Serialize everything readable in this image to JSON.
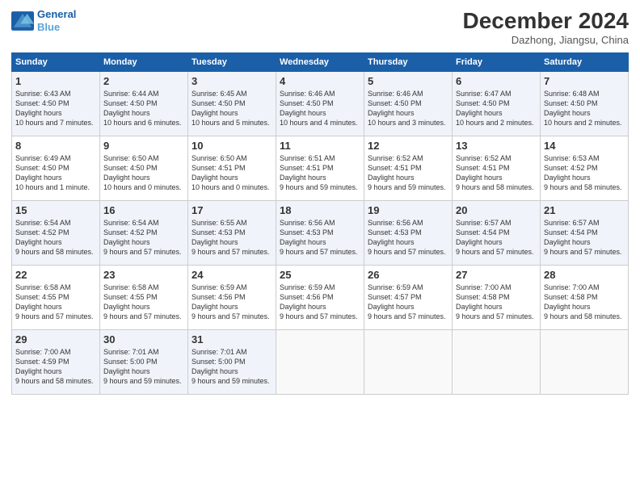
{
  "header": {
    "logo_line1": "General",
    "logo_line2": "Blue",
    "month": "December 2024",
    "location": "Dazhong, Jiangsu, China"
  },
  "weekdays": [
    "Sunday",
    "Monday",
    "Tuesday",
    "Wednesday",
    "Thursday",
    "Friday",
    "Saturday"
  ],
  "weeks": [
    [
      {
        "day": "1",
        "sunrise": "6:43 AM",
        "sunset": "4:50 PM",
        "daylight": "10 hours and 7 minutes."
      },
      {
        "day": "2",
        "sunrise": "6:44 AM",
        "sunset": "4:50 PM",
        "daylight": "10 hours and 6 minutes."
      },
      {
        "day": "3",
        "sunrise": "6:45 AM",
        "sunset": "4:50 PM",
        "daylight": "10 hours and 5 minutes."
      },
      {
        "day": "4",
        "sunrise": "6:46 AM",
        "sunset": "4:50 PM",
        "daylight": "10 hours and 4 minutes."
      },
      {
        "day": "5",
        "sunrise": "6:46 AM",
        "sunset": "4:50 PM",
        "daylight": "10 hours and 3 minutes."
      },
      {
        "day": "6",
        "sunrise": "6:47 AM",
        "sunset": "4:50 PM",
        "daylight": "10 hours and 2 minutes."
      },
      {
        "day": "7",
        "sunrise": "6:48 AM",
        "sunset": "4:50 PM",
        "daylight": "10 hours and 2 minutes."
      }
    ],
    [
      {
        "day": "8",
        "sunrise": "6:49 AM",
        "sunset": "4:50 PM",
        "daylight": "10 hours and 1 minute."
      },
      {
        "day": "9",
        "sunrise": "6:50 AM",
        "sunset": "4:50 PM",
        "daylight": "10 hours and 0 minutes."
      },
      {
        "day": "10",
        "sunrise": "6:50 AM",
        "sunset": "4:51 PM",
        "daylight": "10 hours and 0 minutes."
      },
      {
        "day": "11",
        "sunrise": "6:51 AM",
        "sunset": "4:51 PM",
        "daylight": "9 hours and 59 minutes."
      },
      {
        "day": "12",
        "sunrise": "6:52 AM",
        "sunset": "4:51 PM",
        "daylight": "9 hours and 59 minutes."
      },
      {
        "day": "13",
        "sunrise": "6:52 AM",
        "sunset": "4:51 PM",
        "daylight": "9 hours and 58 minutes."
      },
      {
        "day": "14",
        "sunrise": "6:53 AM",
        "sunset": "4:52 PM",
        "daylight": "9 hours and 58 minutes."
      }
    ],
    [
      {
        "day": "15",
        "sunrise": "6:54 AM",
        "sunset": "4:52 PM",
        "daylight": "9 hours and 58 minutes."
      },
      {
        "day": "16",
        "sunrise": "6:54 AM",
        "sunset": "4:52 PM",
        "daylight": "9 hours and 57 minutes."
      },
      {
        "day": "17",
        "sunrise": "6:55 AM",
        "sunset": "4:53 PM",
        "daylight": "9 hours and 57 minutes."
      },
      {
        "day": "18",
        "sunrise": "6:56 AM",
        "sunset": "4:53 PM",
        "daylight": "9 hours and 57 minutes."
      },
      {
        "day": "19",
        "sunrise": "6:56 AM",
        "sunset": "4:53 PM",
        "daylight": "9 hours and 57 minutes."
      },
      {
        "day": "20",
        "sunrise": "6:57 AM",
        "sunset": "4:54 PM",
        "daylight": "9 hours and 57 minutes."
      },
      {
        "day": "21",
        "sunrise": "6:57 AM",
        "sunset": "4:54 PM",
        "daylight": "9 hours and 57 minutes."
      }
    ],
    [
      {
        "day": "22",
        "sunrise": "6:58 AM",
        "sunset": "4:55 PM",
        "daylight": "9 hours and 57 minutes."
      },
      {
        "day": "23",
        "sunrise": "6:58 AM",
        "sunset": "4:55 PM",
        "daylight": "9 hours and 57 minutes."
      },
      {
        "day": "24",
        "sunrise": "6:59 AM",
        "sunset": "4:56 PM",
        "daylight": "9 hours and 57 minutes."
      },
      {
        "day": "25",
        "sunrise": "6:59 AM",
        "sunset": "4:56 PM",
        "daylight": "9 hours and 57 minutes."
      },
      {
        "day": "26",
        "sunrise": "6:59 AM",
        "sunset": "4:57 PM",
        "daylight": "9 hours and 57 minutes."
      },
      {
        "day": "27",
        "sunrise": "7:00 AM",
        "sunset": "4:58 PM",
        "daylight": "9 hours and 57 minutes."
      },
      {
        "day": "28",
        "sunrise": "7:00 AM",
        "sunset": "4:58 PM",
        "daylight": "9 hours and 58 minutes."
      }
    ],
    [
      {
        "day": "29",
        "sunrise": "7:00 AM",
        "sunset": "4:59 PM",
        "daylight": "9 hours and 58 minutes."
      },
      {
        "day": "30",
        "sunrise": "7:01 AM",
        "sunset": "5:00 PM",
        "daylight": "9 hours and 59 minutes."
      },
      {
        "day": "31",
        "sunrise": "7:01 AM",
        "sunset": "5:00 PM",
        "daylight": "9 hours and 59 minutes."
      },
      null,
      null,
      null,
      null
    ]
  ]
}
